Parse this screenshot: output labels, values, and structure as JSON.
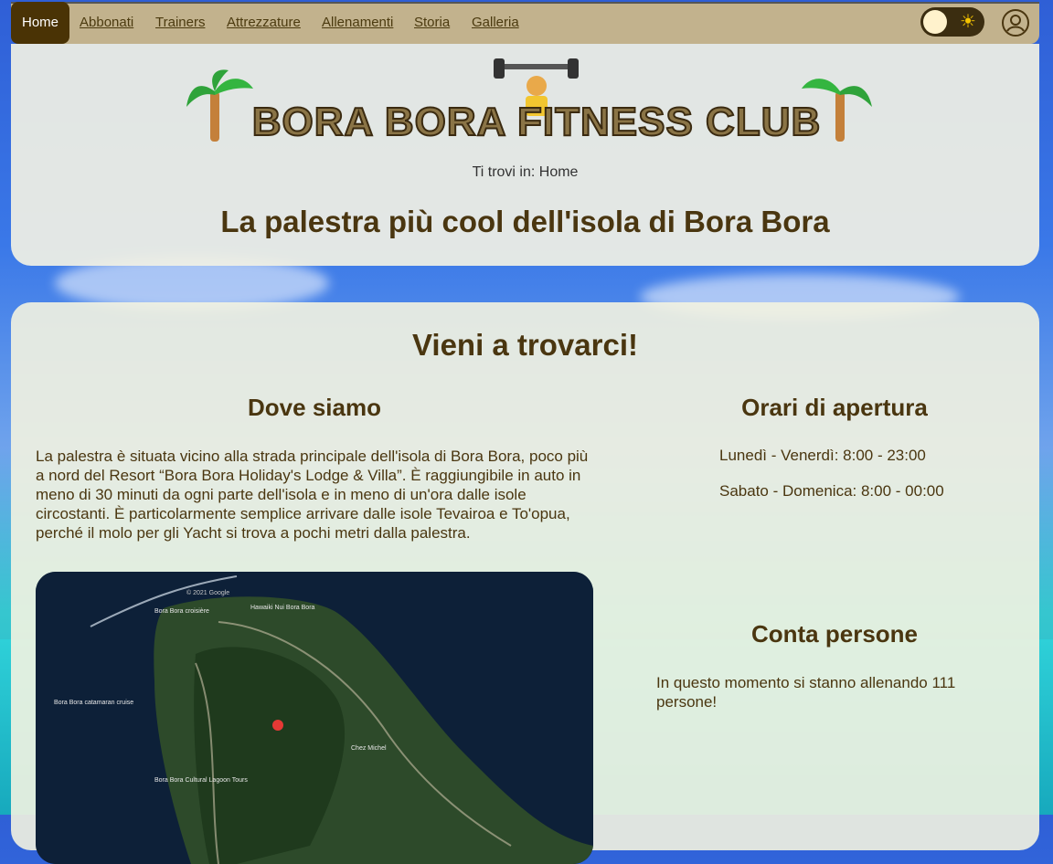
{
  "nav": {
    "items": [
      {
        "label": "Home",
        "active": true
      },
      {
        "label": "Abbonati"
      },
      {
        "label": "Trainers"
      },
      {
        "label": "Attrezzature"
      },
      {
        "label": "Allenamenti"
      },
      {
        "label": "Storia"
      },
      {
        "label": "Galleria"
      }
    ],
    "theme_toggle_icon": "sun-icon",
    "user_icon": "user-icon"
  },
  "header": {
    "logo_text": "BORA BORA FITNESS CLUB",
    "breadcrumb": "Ti trovi in: Home",
    "title": "La palestra più cool dell'isola di Bora Bora"
  },
  "main": {
    "title": "Vieni a trovarci!",
    "location": {
      "title": "Dove siamo",
      "text": "La palestra è situata vicino alla strada principale dell'isola di Bora Bora, poco più a nord del Resort “Bora Bora Holiday's Lodge & Villa”. È raggiungibile in auto in meno di 30 minuti da ogni parte dell'isola e in meno di un'ora dalle isole circostanti. È particolarmente semplice arrivare dalle isole Tevairoa e To'opua, perché il molo per gli Yacht si trova a pochi metri dalla palestra."
    },
    "hours": {
      "title": "Orari di apertura",
      "lines": [
        "Lunedì - Venerdì: 8:00 - 23:00",
        "Sabato - Domenica: 8:00 - 00:00"
      ]
    },
    "people": {
      "title": "Conta persone",
      "text": "In questo momento si stanno allenando 111 persone!"
    },
    "map": {
      "copyright": "© 2021 Google",
      "labels": [
        "Bora Bora croisière",
        "Hawaiki Nui Bora Bora",
        "Bora Bora catamaran cruise",
        "Bora Bora Cultural Lagoon Tours",
        "Chez Michel"
      ]
    }
  },
  "colors": {
    "nav_bg": "#c2b28d",
    "active_bg": "#4a3305",
    "text_brown": "#4a3610"
  }
}
